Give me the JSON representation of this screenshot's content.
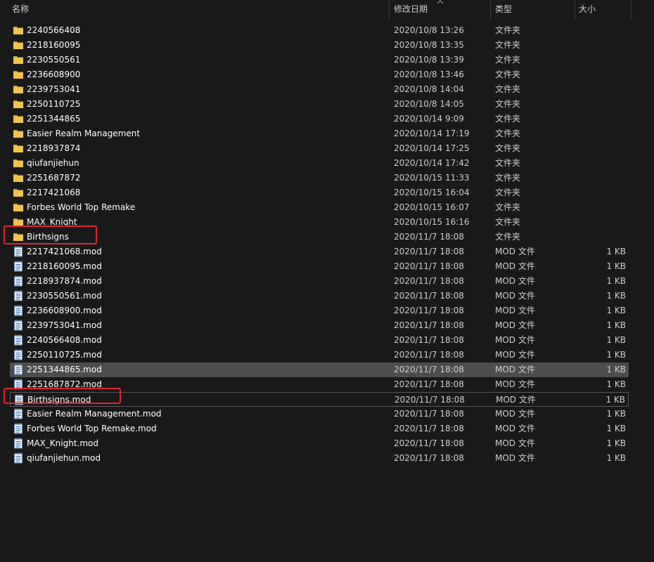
{
  "header": {
    "name_label": "名称",
    "date_label": "修改日期",
    "type_label": "类型",
    "size_label": "大小"
  },
  "colors": {
    "background": "#191919",
    "selected_row": "#4d4d4d",
    "highlight_box": "#e0262b",
    "folder_icon": "#f3c34d"
  },
  "icons": {
    "folder": "folder-icon",
    "file": "notepad-file-icon",
    "sort": "sort-ascending-icon"
  },
  "files": [
    {
      "name": "2240566408",
      "date": "2020/10/8 13:26",
      "type": "文件夹",
      "size": "",
      "kind": "folder"
    },
    {
      "name": "2218160095",
      "date": "2020/10/8 13:35",
      "type": "文件夹",
      "size": "",
      "kind": "folder"
    },
    {
      "name": "2230550561",
      "date": "2020/10/8 13:39",
      "type": "文件夹",
      "size": "",
      "kind": "folder"
    },
    {
      "name": "2236608900",
      "date": "2020/10/8 13:46",
      "type": "文件夹",
      "size": "",
      "kind": "folder"
    },
    {
      "name": "2239753041",
      "date": "2020/10/8 14:04",
      "type": "文件夹",
      "size": "",
      "kind": "folder"
    },
    {
      "name": "2250110725",
      "date": "2020/10/8 14:05",
      "type": "文件夹",
      "size": "",
      "kind": "folder"
    },
    {
      "name": "2251344865",
      "date": "2020/10/14 9:09",
      "type": "文件夹",
      "size": "",
      "kind": "folder"
    },
    {
      "name": "Easier Realm Management",
      "date": "2020/10/14 17:19",
      "type": "文件夹",
      "size": "",
      "kind": "folder"
    },
    {
      "name": "2218937874",
      "date": "2020/10/14 17:25",
      "type": "文件夹",
      "size": "",
      "kind": "folder"
    },
    {
      "name": "qiufanjiehun",
      "date": "2020/10/14 17:42",
      "type": "文件夹",
      "size": "",
      "kind": "folder"
    },
    {
      "name": "2251687872",
      "date": "2020/10/15 11:33",
      "type": "文件夹",
      "size": "",
      "kind": "folder"
    },
    {
      "name": "2217421068",
      "date": "2020/10/15 16:04",
      "type": "文件夹",
      "size": "",
      "kind": "folder"
    },
    {
      "name": "Forbes World Top Remake",
      "date": "2020/10/15 16:07",
      "type": "文件夹",
      "size": "",
      "kind": "folder"
    },
    {
      "name": "MAX_Knight",
      "date": "2020/10/15 16:16",
      "type": "文件夹",
      "size": "",
      "kind": "folder"
    },
    {
      "name": "Birthsigns",
      "date": "2020/11/7 18:08",
      "type": "文件夹",
      "size": "",
      "kind": "folder",
      "highlighted": true
    },
    {
      "name": "2217421068.mod",
      "date": "2020/11/7 18:08",
      "type": "MOD 文件",
      "size": "1 KB",
      "kind": "file"
    },
    {
      "name": "2218160095.mod",
      "date": "2020/11/7 18:08",
      "type": "MOD 文件",
      "size": "1 KB",
      "kind": "file"
    },
    {
      "name": "2218937874.mod",
      "date": "2020/11/7 18:08",
      "type": "MOD 文件",
      "size": "1 KB",
      "kind": "file"
    },
    {
      "name": "2230550561.mod",
      "date": "2020/11/7 18:08",
      "type": "MOD 文件",
      "size": "1 KB",
      "kind": "file"
    },
    {
      "name": "2236608900.mod",
      "date": "2020/11/7 18:08",
      "type": "MOD 文件",
      "size": "1 KB",
      "kind": "file"
    },
    {
      "name": "2239753041.mod",
      "date": "2020/11/7 18:08",
      "type": "MOD 文件",
      "size": "1 KB",
      "kind": "file"
    },
    {
      "name": "2240566408.mod",
      "date": "2020/11/7 18:08",
      "type": "MOD 文件",
      "size": "1 KB",
      "kind": "file"
    },
    {
      "name": "2250110725.mod",
      "date": "2020/11/7 18:08",
      "type": "MOD 文件",
      "size": "1 KB",
      "kind": "file"
    },
    {
      "name": "2251344865.mod",
      "date": "2020/11/7 18:08",
      "type": "MOD 文件",
      "size": "1 KB",
      "kind": "file",
      "selected": true
    },
    {
      "name": "2251687872.mod",
      "date": "2020/11/7 18:08",
      "type": "MOD 文件",
      "size": "1 KB",
      "kind": "file"
    },
    {
      "name": "Birthsigns.mod",
      "date": "2020/11/7 18:08",
      "type": "MOD 文件",
      "size": "1 KB",
      "kind": "file",
      "focused": true,
      "highlighted": true
    },
    {
      "name": "Easier Realm Management.mod",
      "date": "2020/11/7 18:08",
      "type": "MOD 文件",
      "size": "1 KB",
      "kind": "file"
    },
    {
      "name": "Forbes World Top Remake.mod",
      "date": "2020/11/7 18:08",
      "type": "MOD 文件",
      "size": "1 KB",
      "kind": "file"
    },
    {
      "name": "MAX_Knight.mod",
      "date": "2020/11/7 18:08",
      "type": "MOD 文件",
      "size": "1 KB",
      "kind": "file"
    },
    {
      "name": "qiufanjiehun.mod",
      "date": "2020/11/7 18:08",
      "type": "MOD 文件",
      "size": "1 KB",
      "kind": "file"
    }
  ]
}
